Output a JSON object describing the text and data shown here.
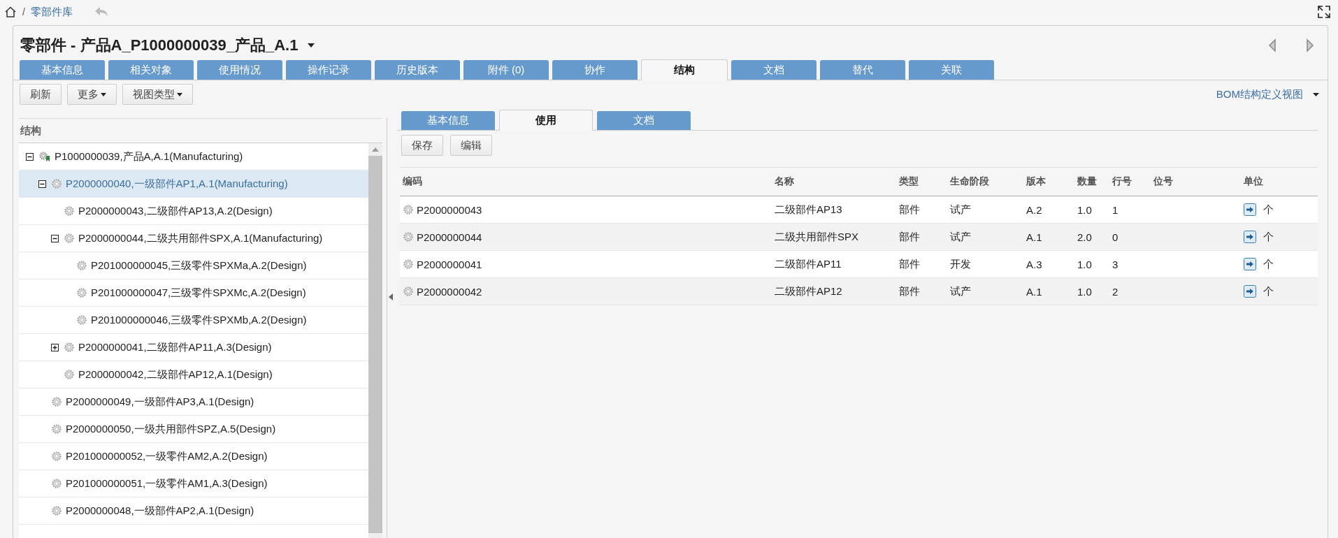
{
  "breadcrumb": {
    "separator": "/",
    "current": "零部件库"
  },
  "title": "零部件 - 产品A_P1000000039_产品_A.1",
  "tabs": [
    {
      "label": "基本信息",
      "selected": false
    },
    {
      "label": "相关对象",
      "selected": false
    },
    {
      "label": "使用情况",
      "selected": false
    },
    {
      "label": "操作记录",
      "selected": false
    },
    {
      "label": "历史版本",
      "selected": false
    },
    {
      "label": "附件 (0)",
      "selected": false
    },
    {
      "label": "协作",
      "selected": false
    },
    {
      "label": "结构",
      "selected": true
    },
    {
      "label": "文档",
      "selected": false
    },
    {
      "label": "替代",
      "selected": false
    },
    {
      "label": "关联",
      "selected": false
    }
  ],
  "toolbar": [
    {
      "label": "刷新",
      "dropdown": false
    },
    {
      "label": "更多",
      "dropdown": true
    },
    {
      "label": "视图类型",
      "dropdown": true
    }
  ],
  "view_selector": "BOM结构定义视图",
  "structure": {
    "header": "结构",
    "nodes": [
      {
        "label": "P1000000039,产品A,A.1(Manufacturing)",
        "kind": "product",
        "expanded": true,
        "selected": false,
        "children": [
          {
            "label": "P2000000040,一级部件AP1,A.1(Manufacturing)",
            "kind": "part",
            "expanded": true,
            "selected": true,
            "children": [
              {
                "label": "P2000000043,二级部件AP13,A.2(Design)",
                "kind": "part",
                "selected": false
              },
              {
                "label": "P2000000044,二级共用部件SPX,A.1(Manufacturing)",
                "kind": "part",
                "expanded": true,
                "selected": false,
                "children": [
                  {
                    "label": "P201000000045,三级零件SPXMa,A.2(Design)",
                    "kind": "part",
                    "selected": false
                  },
                  {
                    "label": "P201000000047,三级零件SPXMc,A.2(Design)",
                    "kind": "part",
                    "selected": false
                  },
                  {
                    "label": "P201000000046,三级零件SPXMb,A.2(Design)",
                    "kind": "part",
                    "selected": false
                  }
                ]
              },
              {
                "label": "P2000000041,二级部件AP11,A.3(Design)",
                "kind": "part",
                "expanded": false,
                "selected": false
              },
              {
                "label": "P2000000042,二级部件AP12,A.1(Design)",
                "kind": "part",
                "selected": false
              }
            ]
          },
          {
            "label": "P2000000049,一级部件AP3,A.1(Design)",
            "kind": "part",
            "selected": false
          },
          {
            "label": "P2000000050,一级共用部件SPZ,A.5(Design)",
            "kind": "part",
            "selected": false
          },
          {
            "label": "P201000000052,一级零件AM2,A.2(Design)",
            "kind": "part",
            "selected": false
          },
          {
            "label": "P201000000051,一级零件AM1,A.3(Design)",
            "kind": "part",
            "selected": false
          },
          {
            "label": "P2000000048,一级部件AP2,A.1(Design)",
            "kind": "part",
            "selected": false
          }
        ]
      }
    ]
  },
  "detail_tabs": [
    {
      "label": "基本信息",
      "selected": false
    },
    {
      "label": "使用",
      "selected": true
    },
    {
      "label": "文档",
      "selected": false
    }
  ],
  "detail_buttons": [
    "保存",
    "编辑"
  ],
  "table": {
    "columns": [
      "编码",
      "名称",
      "类型",
      "生命阶段",
      "版本",
      "数量",
      "行号",
      "位号",
      "单位"
    ],
    "rows": [
      {
        "code": "P2000000043",
        "name": "二级部件AP13",
        "type": "部件",
        "stage": "试产",
        "version": "A.2",
        "quantity": "1.0",
        "line": "1",
        "unit": "个"
      },
      {
        "code": "P2000000044",
        "name": "二级共用部件SPX",
        "type": "部件",
        "stage": "试产",
        "version": "A.1",
        "quantity": "2.0",
        "line": "0",
        "unit": "个"
      },
      {
        "code": "P2000000041",
        "name": "二级部件AP11",
        "type": "部件",
        "stage": "开发",
        "version": "A.3",
        "quantity": "1.0",
        "line": "3",
        "unit": "个"
      },
      {
        "code": "P2000000042",
        "name": "二级部件AP12",
        "type": "部件",
        "stage": "试产",
        "version": "A.1",
        "quantity": "1.0",
        "line": "2",
        "unit": "个"
      }
    ]
  }
}
